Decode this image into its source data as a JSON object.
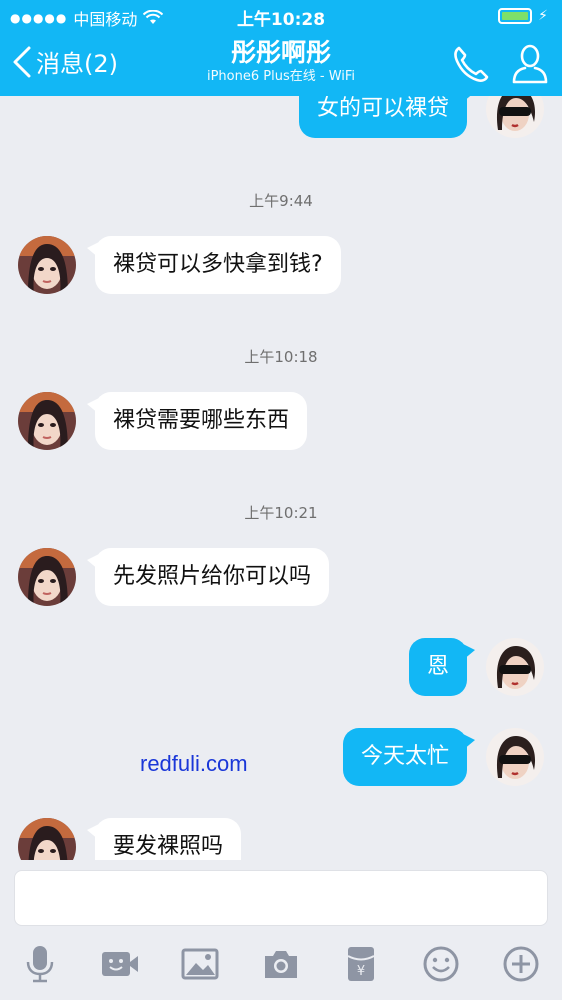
{
  "status_bar": {
    "signal_dots": "●●●●●",
    "carrier": "中国移动",
    "time": "上午10:28"
  },
  "nav": {
    "back_label": "消息(2)",
    "title": "彤彤啊彤",
    "subtitle": "iPhone6 Plus在线 - WiFi"
  },
  "messages": [
    {
      "type": "out",
      "text": "女的可以裸贷"
    },
    {
      "type": "time",
      "text": "上午9:44"
    },
    {
      "type": "in",
      "text": "裸贷可以多快拿到钱?"
    },
    {
      "type": "time",
      "text": "上午10:18"
    },
    {
      "type": "in",
      "text": "裸贷需要哪些东西"
    },
    {
      "type": "time",
      "text": "上午10:21"
    },
    {
      "type": "in",
      "text": "先发照片给你可以吗"
    },
    {
      "type": "out",
      "text": "恩"
    },
    {
      "type": "out",
      "text": "今天太忙"
    },
    {
      "type": "in",
      "text": "要发裸照吗"
    }
  ],
  "watermark": "redfuli.com",
  "input": {
    "value": ""
  },
  "toolbar": [
    "microphone-icon",
    "video-icon",
    "image-icon",
    "camera-icon",
    "red-packet-icon",
    "emoji-icon",
    "plus-icon"
  ],
  "colors": {
    "accent": "#12b7f5",
    "background": "#ebedf2",
    "watermark": "#1a37d8"
  }
}
